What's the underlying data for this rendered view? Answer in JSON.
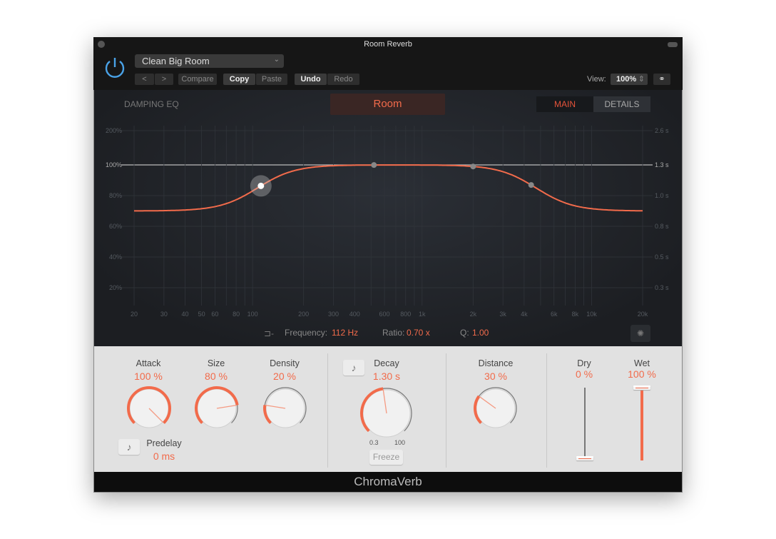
{
  "window": {
    "title": "Room Reverb"
  },
  "header": {
    "preset": "Clean Big Room",
    "prev": "<",
    "next": ">",
    "compare": "Compare",
    "copy": "Copy",
    "paste": "Paste",
    "undo": "Undo",
    "redo": "Redo",
    "view_label": "View:",
    "view_value": "100%"
  },
  "eq": {
    "section_label": "DAMPING EQ",
    "room_mode": "Room",
    "tabs": [
      {
        "label": "MAIN",
        "active": true
      },
      {
        "label": "DETAILS",
        "active": false
      }
    ],
    "y_left_ticks": [
      "200%",
      "100%",
      "80%",
      "60%",
      "40%",
      "20%"
    ],
    "y_right_ticks": [
      "2.6 s",
      "1.3 s",
      "1.0 s",
      "0.8 s",
      "0.5 s",
      "0.3 s"
    ],
    "freq_labels": [
      "20",
      "30",
      "40",
      "50",
      "60",
      "80",
      "100",
      "200",
      "300",
      "400",
      "600",
      "800",
      "1k",
      "2k",
      "3k",
      "4k",
      "6k",
      "8k",
      "10k",
      "20k"
    ],
    "frequency_label": "Frequency:",
    "frequency_value": "112 Hz",
    "ratio_label": "Ratio:",
    "ratio_value": "0.70 x",
    "q_label": "Q:",
    "q_value": "1.00",
    "curve_low_pct": 70,
    "curve_high_pct": 70,
    "nodes_hz": [
      112,
      520,
      2000,
      4400
    ],
    "selected_node_hz": 112
  },
  "controls": {
    "attack": {
      "label": "Attack",
      "value": "100 %",
      "position": 1.0
    },
    "size": {
      "label": "Size",
      "value": "80 %",
      "position": 0.8
    },
    "density": {
      "label": "Density",
      "value": "20 %",
      "position": 0.2
    },
    "predelay": {
      "label": "Predelay",
      "value": "0 ms"
    },
    "decay": {
      "label": "Decay",
      "value": "1.30 s",
      "position": 0.47,
      "min": "0.3",
      "max": "100",
      "freeze": "Freeze"
    },
    "distance": {
      "label": "Distance",
      "value": "30 %",
      "position": 0.3
    },
    "dry": {
      "label": "Dry",
      "value": "0 %",
      "position": 0
    },
    "wet": {
      "label": "Wet",
      "value": "100 %",
      "position": 1
    }
  },
  "footer": {
    "product": "ChromaVerb"
  },
  "colors": {
    "accent": "#f26b4b",
    "power": "#4aa3e8"
  }
}
